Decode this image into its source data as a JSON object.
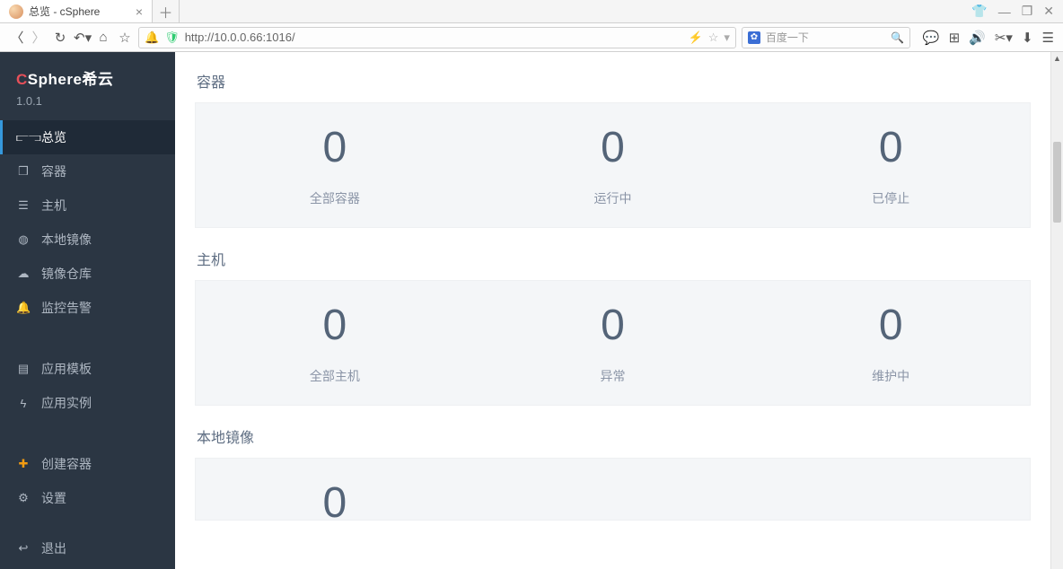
{
  "browser": {
    "tab_title": "总览 - cSphere",
    "url": "http://10.0.0.66:1016/",
    "search_placeholder": "百度一下"
  },
  "sidebar": {
    "brand_prefix": "C",
    "brand_rest": "Sphere希云",
    "version": "1.0.1",
    "items": [
      {
        "icon": "chart-icon",
        "glyph": "⫍⫎",
        "label": "总览",
        "active": true
      },
      {
        "icon": "cube-icon",
        "glyph": "❒",
        "label": "容器"
      },
      {
        "icon": "server-icon",
        "glyph": "☰",
        "label": "主机"
      },
      {
        "icon": "disk-icon",
        "glyph": "◍",
        "label": "本地镜像"
      },
      {
        "icon": "cloud-icon",
        "glyph": "☁",
        "label": "镜像仓库"
      },
      {
        "icon": "bell-icon",
        "glyph": "🔔",
        "label": "监控告警"
      }
    ],
    "items2": [
      {
        "icon": "template-icon",
        "glyph": "▤",
        "label": "应用模板"
      },
      {
        "icon": "bolt-icon",
        "glyph": "ϟ",
        "label": "应用实例"
      }
    ],
    "items3": [
      {
        "icon": "plus-icon",
        "glyph": "✚",
        "label": "创建容器",
        "orange": true
      },
      {
        "icon": "gear-icon",
        "glyph": "⚙",
        "label": "设置"
      }
    ],
    "items4": [
      {
        "icon": "exit-icon",
        "glyph": "↩",
        "label": "退出"
      }
    ]
  },
  "sections": [
    {
      "title": "容器",
      "stats": [
        {
          "value": "0",
          "label": "全部容器"
        },
        {
          "value": "0",
          "label": "运行中"
        },
        {
          "value": "0",
          "label": "已停止"
        }
      ]
    },
    {
      "title": "主机",
      "stats": [
        {
          "value": "0",
          "label": "全部主机"
        },
        {
          "value": "0",
          "label": "异常"
        },
        {
          "value": "0",
          "label": "维护中"
        }
      ]
    },
    {
      "title": "本地镜像",
      "stats": [
        {
          "value": "0",
          "label": ""
        },
        {
          "value": "",
          "label": ""
        },
        {
          "value": "",
          "label": ""
        }
      ]
    }
  ]
}
